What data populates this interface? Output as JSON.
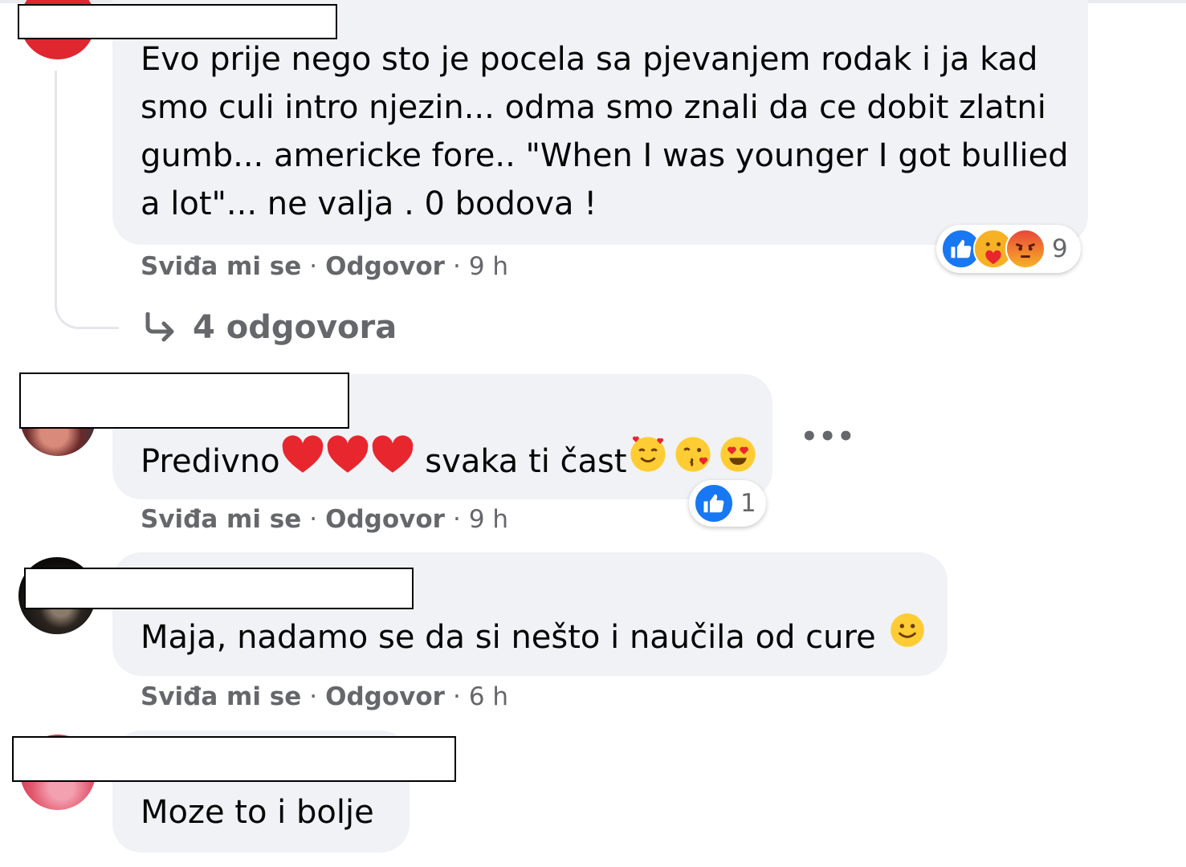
{
  "comments": [
    {
      "text_lines": [
        "Evo prije nego sto je pocela sa pjevanjem rodak i ja kad",
        "smo culi intro njezin... odma smo znali da ce dobit zlatni",
        "gumb... americke fore.. \"When I was younger I got bullied",
        "a lot\"... ne valja . 0 bodova !"
      ],
      "like_label": "Sviđa mi se",
      "reply_label": "Odgovor",
      "time": "9 h",
      "reaction_count": "9",
      "reaction_icons": [
        "like-icon",
        "care-icon",
        "angry-icon"
      ],
      "replies_label": "4 odgovora",
      "colors": {
        "avatar": "#e0262f"
      }
    },
    {
      "text": "Predivno",
      "text_after_hearts": " svaka ti čast",
      "emojis": [
        "heart-icon",
        "heart-icon",
        "heart-icon",
        "smiling-face-with-hearts-icon",
        "face-blowing-kiss-icon",
        "heart-eyes-icon"
      ],
      "like_label": "Sviđa mi se",
      "reply_label": "Odgovor",
      "time": "9 h",
      "reaction_count": "1",
      "reaction_icons": [
        "like-icon"
      ],
      "more_label": "•••",
      "colors": {
        "avatar": "#6b2a2a"
      }
    },
    {
      "text": "Maja, nadamo se da si nešto i naučila od cure",
      "emojis": [
        "slightly-smiling-face-icon"
      ],
      "like_label": "Sviđa mi se",
      "reply_label": "Odgovor",
      "time": "6 h",
      "colors": {
        "avatar": "#2b2520"
      }
    },
    {
      "text": "Moze to i bolje",
      "colors": {
        "avatar": "#e2556b"
      }
    }
  ],
  "separator": "·",
  "colors": {
    "bubble": "#f0f2f5",
    "meta_text": "#65676b",
    "like_blue": "#1877f2",
    "heart_red": "#e8262e",
    "emoji_yellow": "#ffcc33"
  }
}
